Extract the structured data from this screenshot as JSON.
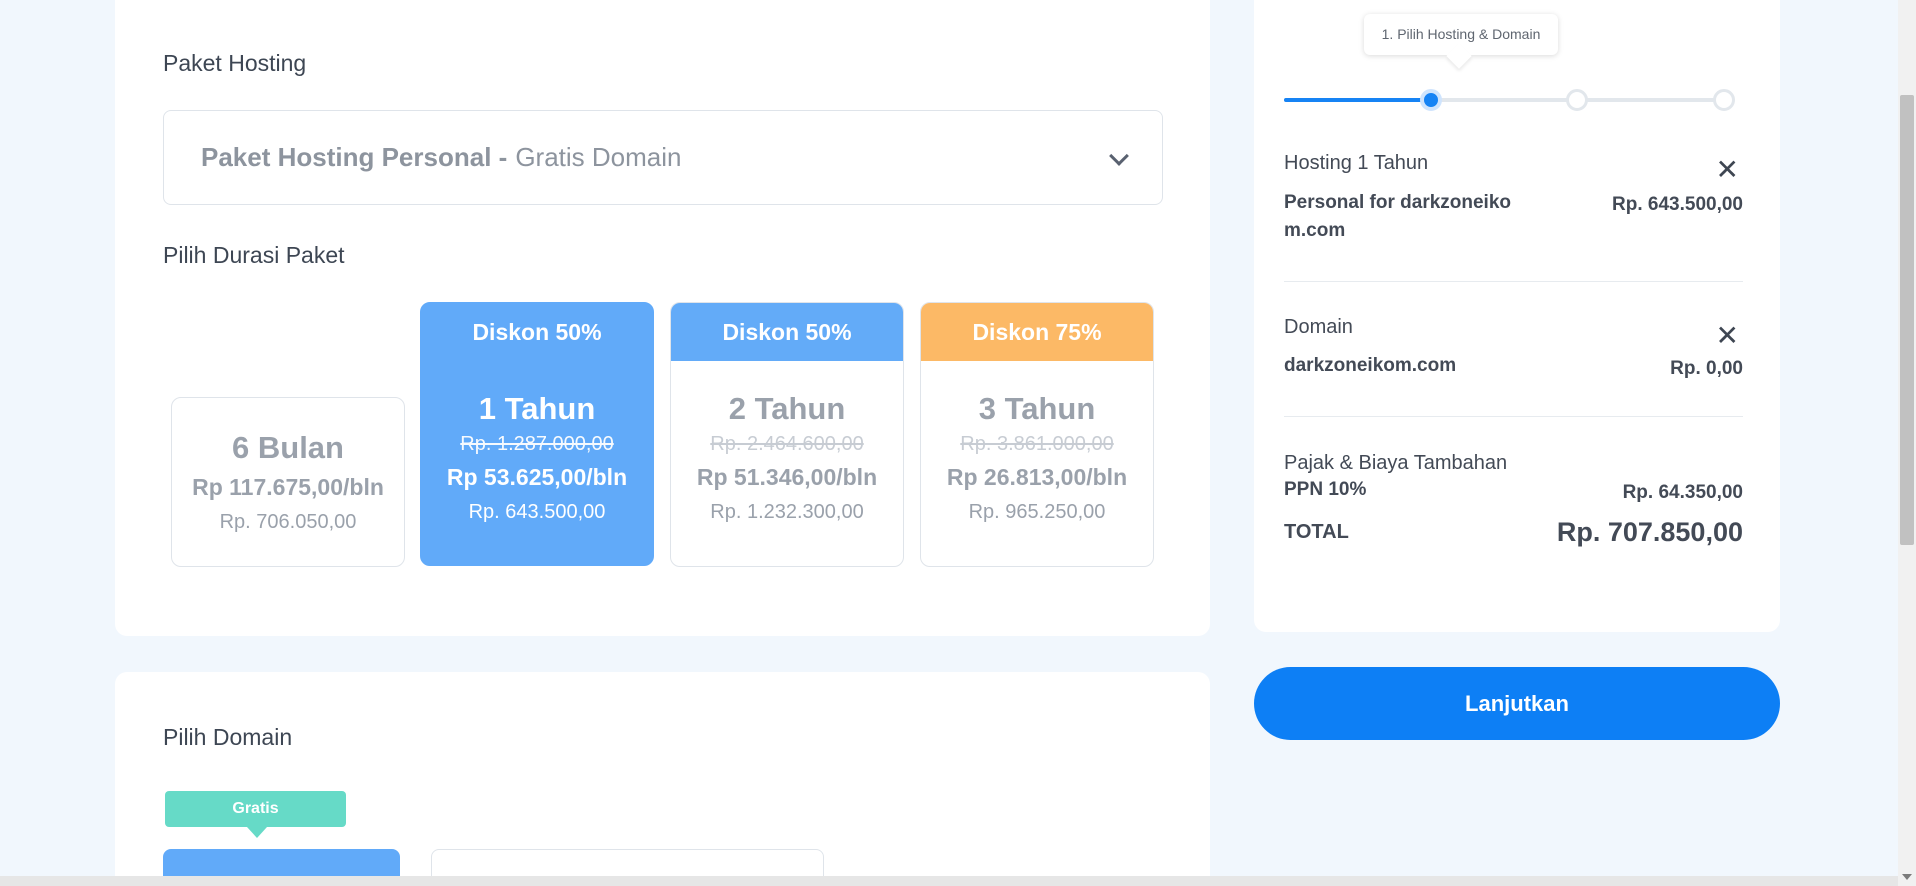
{
  "hosting": {
    "section_title": "Paket Hosting",
    "select": {
      "name": "Paket Hosting Personal -",
      "suffix": "Gratis Domain"
    },
    "duration_title": "Pilih Durasi Paket",
    "durations": [
      {
        "badge": "",
        "period": "6 Bulan",
        "original": "",
        "monthly": "Rp 117.675,00/bln",
        "total": "Rp. 706.050,00",
        "selected": false
      },
      {
        "badge": "Diskon 50%",
        "period": "1 Tahun",
        "original": "Rp. 1.287.000,00",
        "monthly": "Rp 53.625,00/bln",
        "total": "Rp. 643.500,00",
        "selected": true
      },
      {
        "badge": "Diskon 50%",
        "period": "2 Tahun",
        "original": "Rp. 2.464.600,00",
        "monthly": "Rp 51.346,00/bln",
        "total": "Rp. 1.232.300,00",
        "selected": false
      },
      {
        "badge": "Diskon 75%",
        "period": "3 Tahun",
        "original": "Rp. 3.861.000,00",
        "monthly": "Rp 26.813,00/bln",
        "total": "Rp. 965.250,00",
        "selected": false
      }
    ],
    "badge_colors": {
      "selected": "#61aaf9",
      "blue": "#63abf8",
      "orange": "#fcb966"
    }
  },
  "domain": {
    "section_title": "Pilih Domain",
    "gratis_label": "Gratis"
  },
  "summary": {
    "stepper_tooltip": "1. Pilih Hosting & Domain",
    "hosting": {
      "label": "Hosting 1 Tahun",
      "name": "Personal for darkzoneiko\nm.com",
      "name_line1": "Personal for darkzoneiko",
      "name_line2": "m.com",
      "price": "Rp. 643.500,00"
    },
    "domain": {
      "label": "Domain",
      "name": "darkzoneikom.com",
      "price": "Rp. 0,00"
    },
    "tax": {
      "label": "Pajak & Biaya Tambahan",
      "name": "PPN 10%",
      "price": "Rp. 64.350,00"
    },
    "total": {
      "label": "TOTAL",
      "price": "Rp. 707.850,00"
    }
  },
  "actions": {
    "next_label": "Lanjutkan"
  },
  "accent_color": "#0d7ff5"
}
